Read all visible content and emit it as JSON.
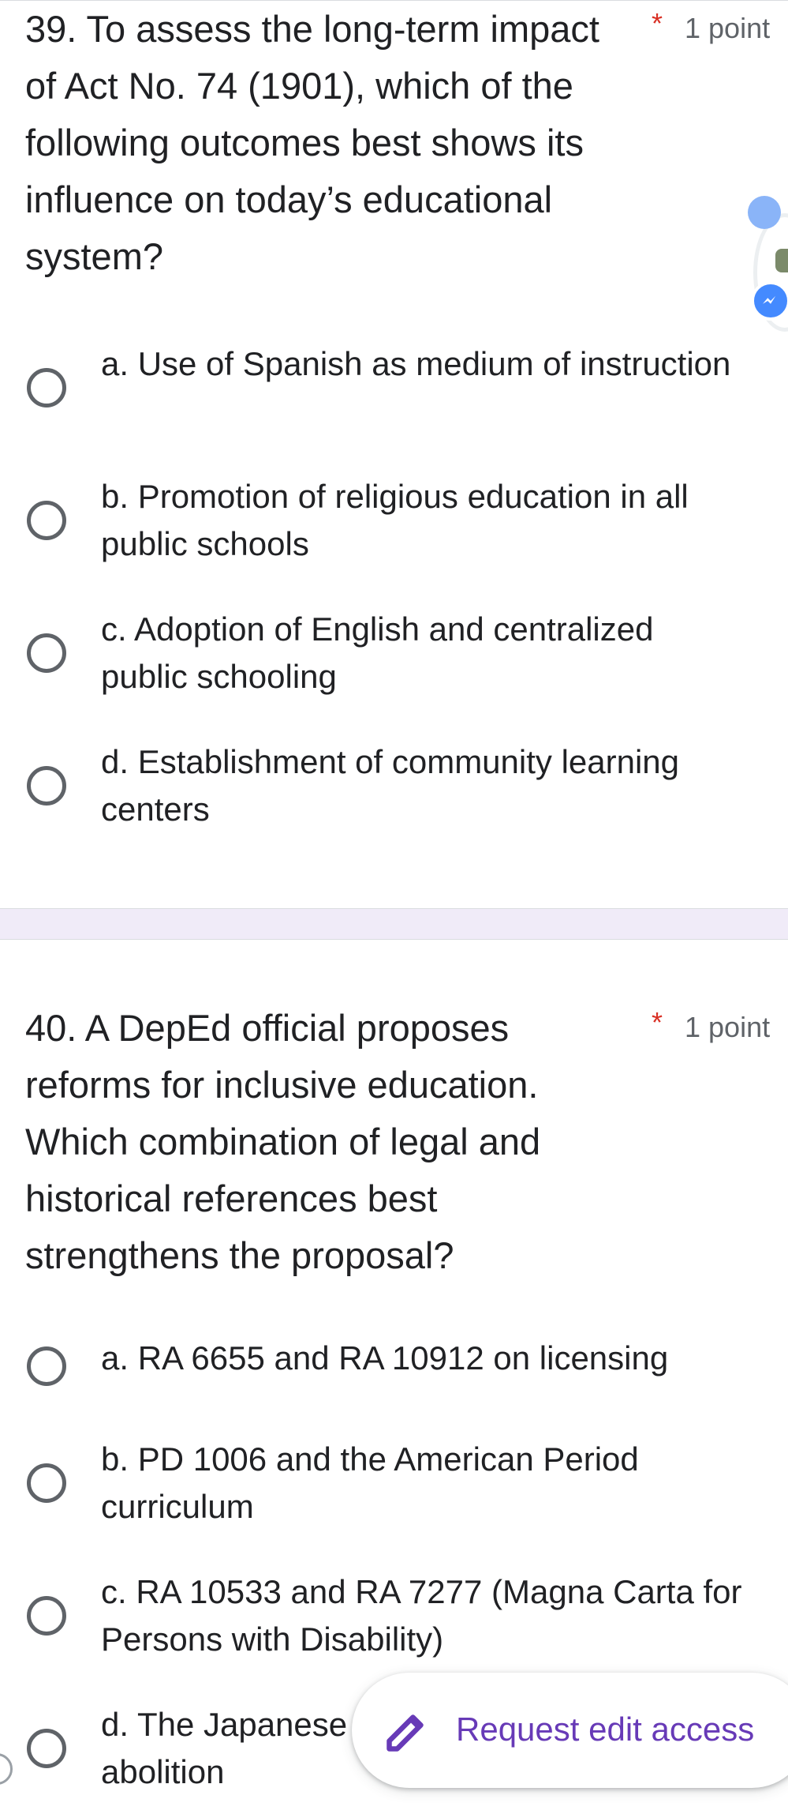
{
  "questions": [
    {
      "text": "39. To assess the long-term impact of Act No. 74 (1901), which of the following outcomes best shows its influence on today’s educational system?",
      "required_mark": "*",
      "points": "1 point",
      "options": [
        {
          "label": "a. Use of Spanish as medium of instruction"
        },
        {
          "label": "b. Promotion of religious education in all public schools"
        },
        {
          "label": "c. Adoption of English and centralized public schooling"
        },
        {
          "label": "d. Establishment of community learning centers"
        }
      ]
    },
    {
      "text": "40. A DepEd official proposes reforms for inclusive education. Which combination of legal and historical references best strengthens the proposal?",
      "required_mark": "*",
      "points": "1 point",
      "options": [
        {
          "label": "a. RA 6655 and RA 10912 on licensing"
        },
        {
          "label": "b. PD 1006 and the American Period curriculum"
        },
        {
          "label": "c. RA 10533 and RA 7277 (Magna Carta for Persons with Disability)"
        },
        {
          "label": "d. The Japanese"
        },
        {
          "label": "abolition"
        }
      ]
    }
  ],
  "request_edit": {
    "label": "Request edit access",
    "icon": "pencil-icon"
  },
  "floating": {
    "messenger_icon": "messenger-icon"
  },
  "colors": {
    "accent": "#673ab7",
    "required": "#d93025",
    "section_band": "#f0ebf8",
    "radio_border": "#5f6368",
    "messenger": "#448aff"
  }
}
